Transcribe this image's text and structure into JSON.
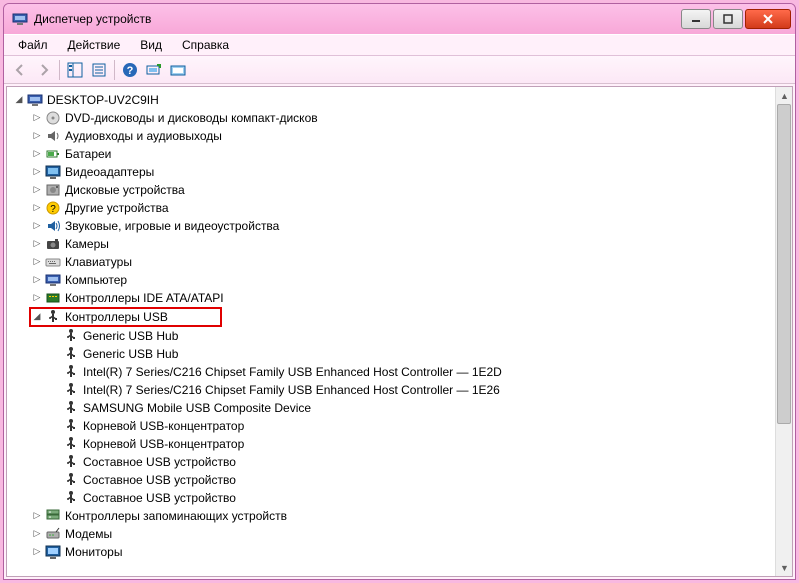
{
  "title": "Диспетчер устройств",
  "menu": {
    "file": "Файл",
    "action": "Действие",
    "view": "Вид",
    "help": "Справка"
  },
  "root": "DESKTOP-UV2C9IH",
  "categories": [
    {
      "label": "DVD-дисководы и дисководы компакт-дисков",
      "icon": "dvd"
    },
    {
      "label": "Аудиовходы и аудиовыходы",
      "icon": "audio"
    },
    {
      "label": "Батареи",
      "icon": "battery"
    },
    {
      "label": "Видеоадаптеры",
      "icon": "display"
    },
    {
      "label": "Дисковые устройства",
      "icon": "disk"
    },
    {
      "label": "Другие устройства",
      "icon": "unknown"
    },
    {
      "label": "Звуковые, игровые и видеоустройства",
      "icon": "sound"
    },
    {
      "label": "Камеры",
      "icon": "camera"
    },
    {
      "label": "Клавиатуры",
      "icon": "keyboard"
    },
    {
      "label": "Компьютер",
      "icon": "computer"
    },
    {
      "label": "Контроллеры IDE ATA/ATAPI",
      "icon": "ide"
    }
  ],
  "usb_category": "Контроллеры USB",
  "usb_children": [
    "Generic USB Hub",
    "Generic USB Hub",
    "Intel(R) 7 Series/C216 Chipset Family USB Enhanced Host Controller — 1E2D",
    "Intel(R) 7 Series/C216 Chipset Family USB Enhanced Host Controller — 1E26",
    "SAMSUNG Mobile USB Composite Device",
    "Корневой USB-концентратор",
    "Корневой USB-концентратор",
    "Составное USB устройство",
    "Составное USB устройство",
    "Составное USB устройство"
  ],
  "trailing_categories": [
    {
      "label": "Контроллеры запоминающих устройств",
      "icon": "storage"
    },
    {
      "label": "Модемы",
      "icon": "modem"
    },
    {
      "label": "Мониторы",
      "icon": "monitor"
    }
  ]
}
